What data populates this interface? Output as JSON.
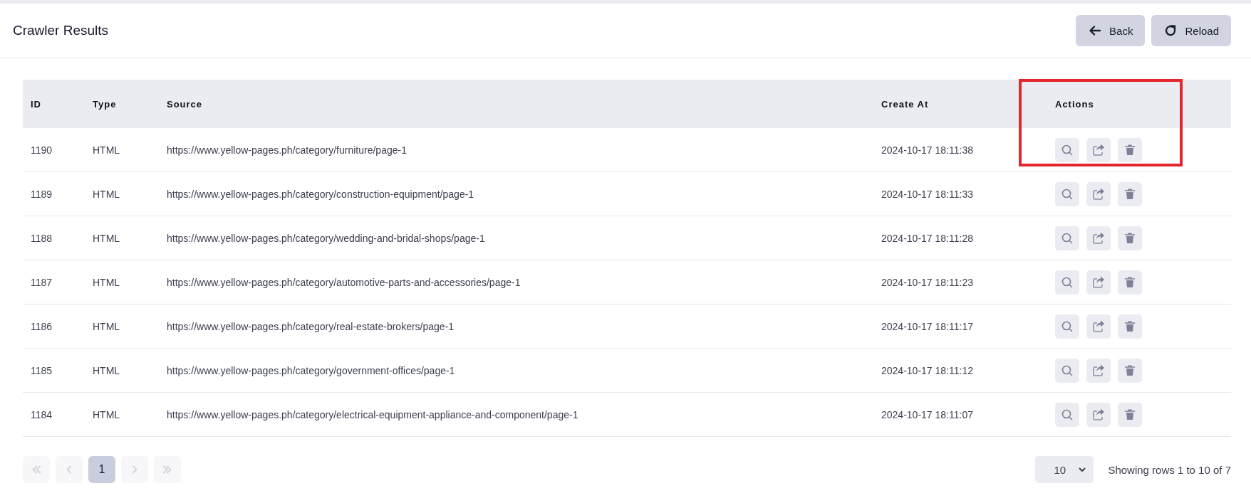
{
  "header": {
    "title": "Crawler Results",
    "buttons": [
      {
        "kind": "back",
        "label": "Back"
      },
      {
        "kind": "reload",
        "label": "Reload"
      }
    ]
  },
  "table": {
    "columns": [
      {
        "label": "ID",
        "highlighted": false
      },
      {
        "label": "Type",
        "highlighted": false
      },
      {
        "label": "Source",
        "highlighted": false
      },
      {
        "label": "Create At",
        "highlighted": false
      },
      {
        "label": "Actions",
        "highlighted": true
      }
    ],
    "rows": [
      {
        "id": "1190",
        "type": "HTML",
        "source": "https://www.yellow-pages.ph/category/furniture/page-1",
        "created": "2024-10-17 18:11:38"
      },
      {
        "id": "1189",
        "type": "HTML",
        "source": "https://www.yellow-pages.ph/category/construction-equipment/page-1",
        "created": "2024-10-17 18:11:33"
      },
      {
        "id": "1188",
        "type": "HTML",
        "source": "https://www.yellow-pages.ph/category/wedding-and-bridal-shops/page-1",
        "created": "2024-10-17 18:11:28"
      },
      {
        "id": "1187",
        "type": "HTML",
        "source": "https://www.yellow-pages.ph/category/automotive-parts-and-accessories/page-1",
        "created": "2024-10-17 18:11:23"
      },
      {
        "id": "1186",
        "type": "HTML",
        "source": "https://www.yellow-pages.ph/category/real-estate-brokers/page-1",
        "created": "2024-10-17 18:11:17"
      },
      {
        "id": "1185",
        "type": "HTML",
        "source": "https://www.yellow-pages.ph/category/government-offices/page-1",
        "created": "2024-10-17 18:11:12"
      },
      {
        "id": "1184",
        "type": "HTML",
        "source": "https://www.yellow-pages.ph/category/electrical-equipment-appliance-and-component/page-1",
        "created": "2024-10-17 18:11:07"
      }
    ]
  },
  "pagination": {
    "pages": [
      {
        "kind": "first",
        "disabled": true,
        "selected": false
      },
      {
        "kind": "prev",
        "disabled": true,
        "selected": false
      },
      {
        "kind": "page",
        "label": "1",
        "disabled": false,
        "selected": true
      },
      {
        "kind": "next",
        "disabled": true,
        "selected": false
      },
      {
        "kind": "last",
        "disabled": true,
        "selected": false
      }
    ],
    "page_size": "10",
    "summary": "Showing rows 1 to 10 of 7"
  }
}
